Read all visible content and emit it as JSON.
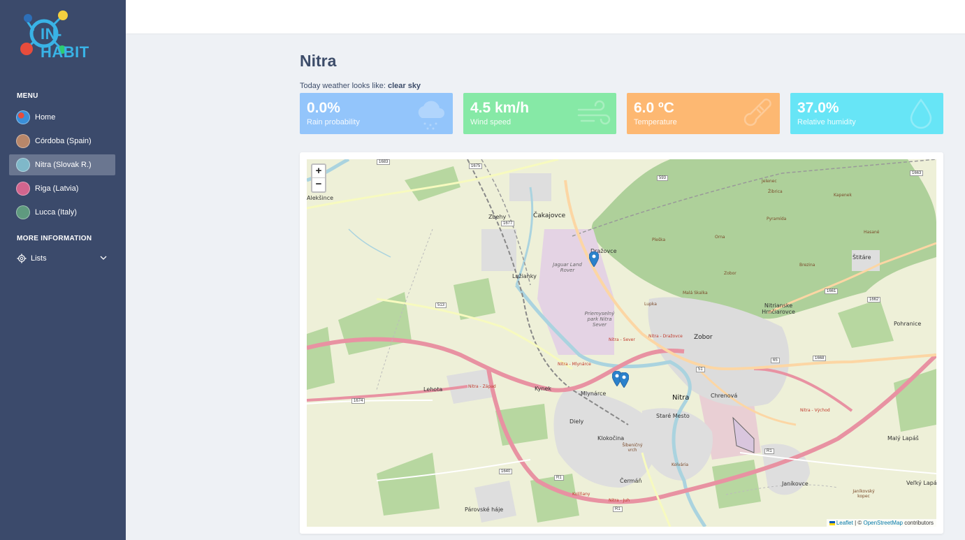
{
  "brand": {
    "logo_text": "IN-HABIT"
  },
  "sidebar": {
    "menu_title": "MENU",
    "items": [
      {
        "label": "Home",
        "icon": "globe-icon",
        "color": "#3a8fd8"
      },
      {
        "label": "Córdoba (Spain)",
        "icon": "cordoba-icon",
        "color": "#b8876a"
      },
      {
        "label": "Nitra (Slovak R.)",
        "icon": "nitra-icon",
        "color": "#7fb8c9",
        "active": true
      },
      {
        "label": "Riga (Latvia)",
        "icon": "riga-icon",
        "color": "#d2658e"
      },
      {
        "label": "Lucca (Italy)",
        "icon": "lucca-icon",
        "color": "#5f9a7f"
      }
    ],
    "more_title": "MORE INFORMATION",
    "lists_label": "Lists"
  },
  "main": {
    "title": "Nitra",
    "weather_prefix": "Today weather looks like: ",
    "weather_value": "clear sky",
    "cards": [
      {
        "value": "0.0%",
        "label": "Rain probability",
        "color": "#93c5fb",
        "icon": "cloud-rain-icon"
      },
      {
        "value": "4.5 km/h",
        "label": "Wind speed",
        "color": "#86e9a6",
        "icon": "wind-icon"
      },
      {
        "value": "6.0 ºC",
        "label": "Temperature",
        "color": "#fdb872",
        "icon": "thermometer-icon"
      },
      {
        "value": "37.0%",
        "label": "Relative humidity",
        "color": "#67e5f6",
        "icon": "droplet-icon"
      }
    ]
  },
  "map": {
    "zoom_in": "+",
    "zoom_out": "−",
    "attribution_leaflet": "Leaflet",
    "attribution_sep": " | © ",
    "attribution_osm": "OpenStreetMap",
    "attribution_tail": " contributors",
    "labels": {
      "cakajovce": "Čakajovce",
      "zbehy": "Zbehy",
      "alekinice": "Alekšince",
      "luzianky": "Lužianky",
      "drazovce": "Dražovce",
      "jaguar": "Jaguar Land Rover",
      "park": "Priemyselný park Nitra Sever",
      "zobor": "Zobor",
      "nitrianske": "Nitrianske Hrnčiarovce",
      "stitare": "Štitáre",
      "pohranice": "Pohranice",
      "lehota": "Lehota",
      "kynek": "Kynek",
      "mlynarce": "Mlynárce",
      "nitra": "Nitra",
      "chrenova": "Chrenová",
      "starmesto": "Staré Mesto",
      "diely": "Diely",
      "klokocina": "Klokočina",
      "sibenicny": "Šibeničný vrch",
      "cerman": "Čermáň",
      "kolvaria": "Kolvária",
      "janikovce": "Janíkovce",
      "janikovsky": "Janíkovský kopec",
      "parovske": "Párovské háje",
      "malylapas": "Malý Lapáš",
      "velkylapas": "Veľký Lapáš",
      "pleska": "Pleška",
      "orna": "Orna",
      "zobor_peak": "Zobor",
      "malaskalka": "Malá Skalka",
      "zibrica": "Žibrica",
      "lupka": "Lupka",
      "hasane": "Hasané",
      "brezina": "Brezina",
      "jelenec": "Jelenec",
      "pyramida": "Pyramída",
      "kapenek": "Kapenek",
      "nitra_sever": "Nitra - Sever",
      "nitra_drazovce": "Nitra - Dražovce",
      "nitra_mlynarce": "Nitra - Mlynárce",
      "nitra_zapad": "Nitra - Západ",
      "nitra_vychod": "Nitra - Východ",
      "nitra_juh": "Nitra - Juh",
      "kolinova": "Kolíňany",
      "r1": "R1",
      "r1b": "R1",
      "r1c": "R1",
      "road_513": "513",
      "road_593": "593",
      "road_1663": "1663",
      "road_1661": "1661",
      "road_1662": "1662",
      "road_1668": "1668",
      "road_1674": "1674",
      "road_1640": "1640",
      "road_1675": "1675",
      "road_1677": "1677",
      "road_1683": "1683",
      "road_65": "65",
      "road_51": "51"
    }
  }
}
